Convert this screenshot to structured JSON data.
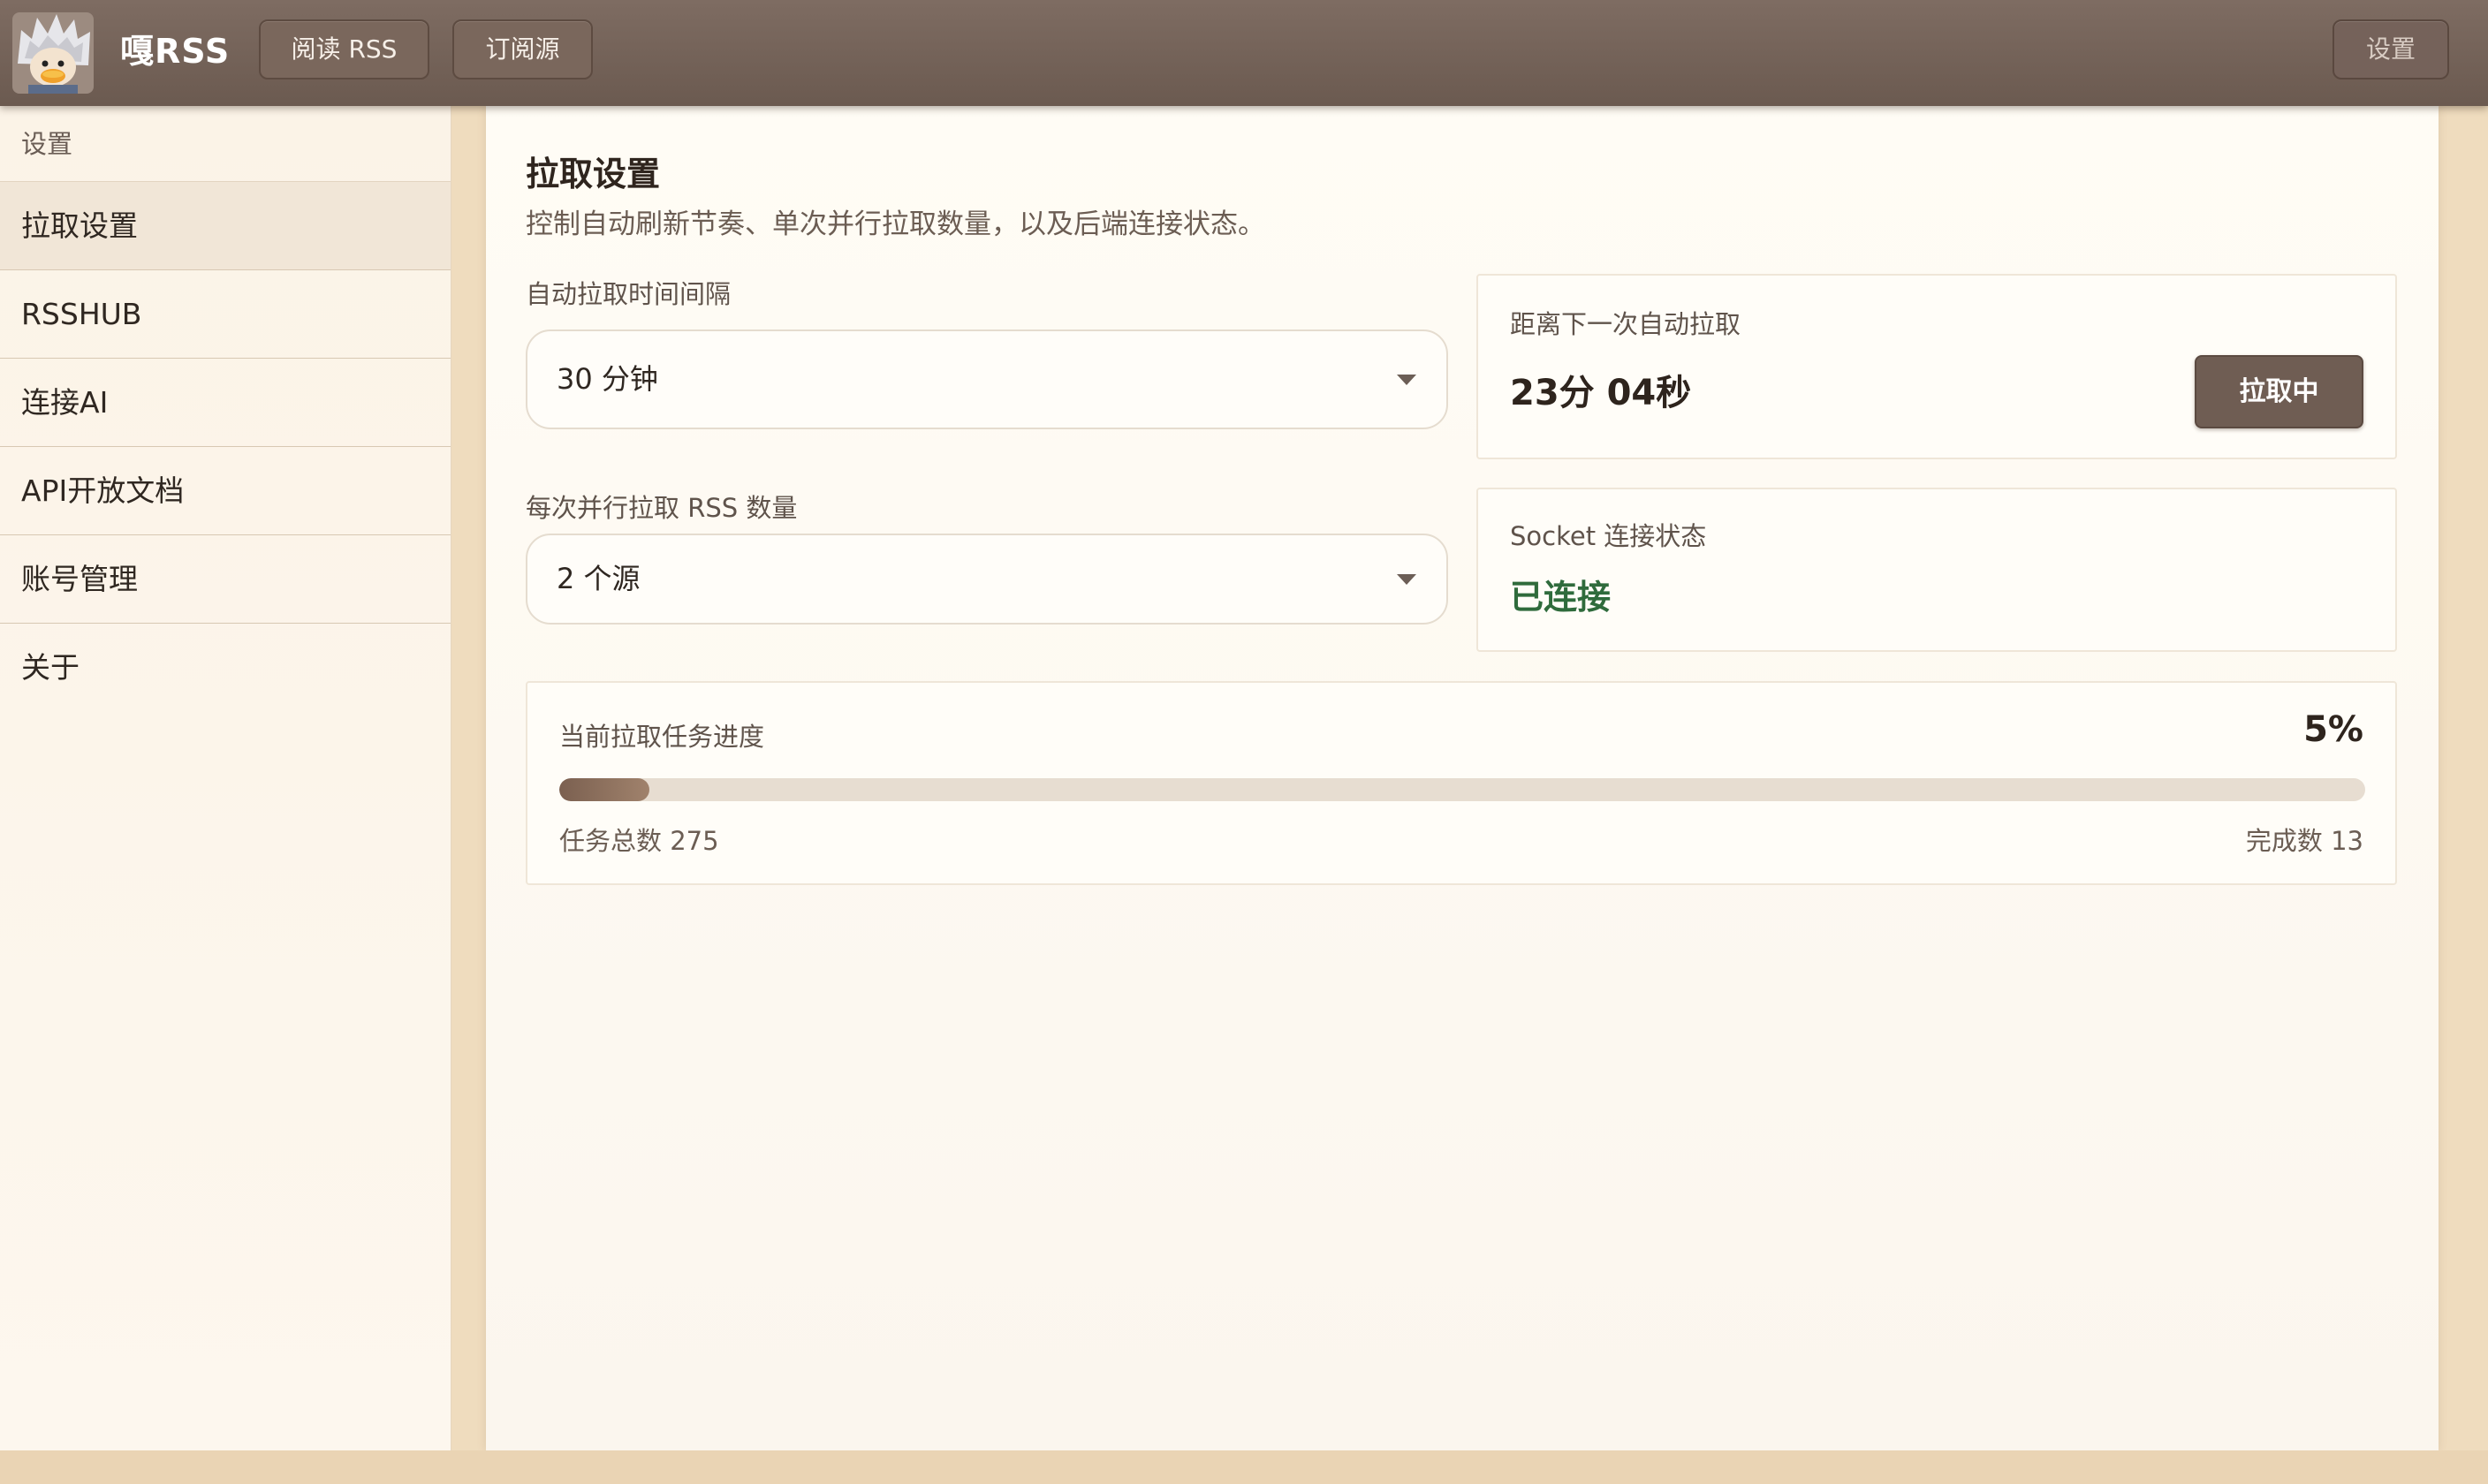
{
  "app": {
    "title": "嘎RSS"
  },
  "topbar": {
    "read_label": "阅读 RSS",
    "subscribe_label": "订阅源",
    "settings_label": "设置"
  },
  "sidebar": {
    "header": "设置",
    "items": [
      {
        "label": "拉取设置",
        "active": true
      },
      {
        "label": "RSSHUB"
      },
      {
        "label": "连接AI"
      },
      {
        "label": "API开放文档"
      },
      {
        "label": "账号管理"
      },
      {
        "label": "关于"
      }
    ]
  },
  "main": {
    "title": "拉取设置",
    "subtitle": "控制自动刷新节奏、单次并行拉取数量，以及后端连接状态。",
    "interval": {
      "label": "自动拉取时间间隔",
      "value": "30 分钟"
    },
    "concurrency": {
      "label": "每次并行拉取 RSS 数量",
      "value": "2 个源"
    },
    "next_fetch": {
      "label": "距离下一次自动拉取",
      "countdown": "23分 04秒",
      "button": "拉取中"
    },
    "socket": {
      "label": "Socket 连接状态",
      "status": "已连接",
      "status_color": "#2f6b3c"
    },
    "progress": {
      "label": "当前拉取任务进度",
      "percent_text": "5%",
      "percent": 5,
      "total_text": "任务总数 275",
      "done_text": "完成数 13"
    }
  },
  "colors": {
    "accent": "#6f5d53",
    "topbar": "#745f55",
    "success": "#2f6b3c"
  }
}
